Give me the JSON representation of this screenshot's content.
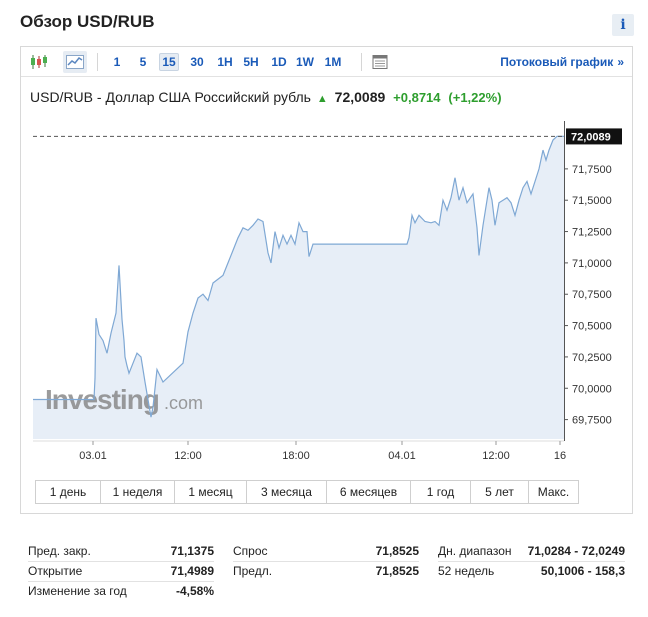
{
  "page_title": "Обзор USD/RUB",
  "info_label": "i",
  "toolbar": {
    "intervals": [
      "1",
      "5",
      "15",
      "30",
      "1H",
      "5H",
      "1D",
      "1W",
      "1M"
    ],
    "active_interval": "15",
    "streaming_label": "Потоковый график",
    "streaming_chevron": "»"
  },
  "quote": {
    "name": "USD/RUB - Доллар США Российский рубль",
    "price": "72,0089",
    "change": "+0,8714",
    "change_pct": "(+1,22%)",
    "direction_color": "#2e9e2e"
  },
  "watermark": {
    "brand": "Investing",
    "suffix": ".com"
  },
  "ranges": [
    "1 день",
    "1 неделя",
    "1 месяц",
    "3 месяца",
    "6 месяцев",
    "1 год",
    "5 лет",
    "Макс."
  ],
  "stats": [
    [
      {
        "label": "Пред. закр.",
        "value": "71,1375"
      },
      {
        "label": "Открытие",
        "value": "71,4989"
      },
      {
        "label": "Изменение за год",
        "value": "-4,58%"
      }
    ],
    [
      {
        "label": "Спрос",
        "value": "71,8525"
      },
      {
        "label": "Предл.",
        "value": "71,8525"
      }
    ],
    [
      {
        "label": "Дн. диапазон",
        "value": "71,0284 - 72,0249"
      },
      {
        "label": "52 недель",
        "value": "50,1006 - 158,3"
      }
    ]
  ],
  "chart_data": {
    "type": "area",
    "ylim": [
      69.675,
      72.1
    ],
    "y_ticks": [
      69.75,
      70.0,
      70.25,
      70.5,
      70.75,
      71.0,
      71.25,
      71.5,
      71.75
    ],
    "y_tick_labels": [
      "69,7500",
      "70,0000",
      "70,2500",
      "70,5000",
      "70,7500",
      "71,0000",
      "71,2500",
      "71,5000",
      "71,7500"
    ],
    "x_tick_labels": [
      "03.01",
      "12:00",
      "18:00",
      "04.01",
      "12:00",
      "16"
    ],
    "last_value": 72.0089,
    "last_label": "72,0089",
    "line_color": "#7fa8d4",
    "fill_color": "#e7eef7",
    "series": [
      {
        "points": [
          [
            0,
            69.91
          ],
          [
            61,
            69.91
          ],
          [
            62,
            70.08
          ],
          [
            63,
            70.56
          ],
          [
            66,
            70.43
          ],
          [
            70,
            70.38
          ],
          [
            74,
            70.28
          ],
          [
            78,
            70.44
          ],
          [
            83,
            70.6
          ],
          [
            86,
            70.98
          ],
          [
            89,
            70.55
          ],
          [
            91,
            70.38
          ],
          [
            92,
            70.25
          ],
          [
            94,
            70.18
          ],
          [
            96,
            70.12
          ],
          [
            100,
            70.2
          ],
          [
            104,
            70.28
          ],
          [
            108,
            70.25
          ],
          [
            112,
            70.05
          ],
          [
            118,
            69.77
          ],
          [
            120,
            69.85
          ],
          [
            124,
            70.15
          ],
          [
            130,
            70.05
          ],
          [
            150,
            70.2
          ],
          [
            155,
            70.45
          ],
          [
            160,
            70.6
          ],
          [
            165,
            70.72
          ],
          [
            170,
            70.75
          ],
          [
            175,
            70.7
          ],
          [
            180,
            70.84
          ],
          [
            190,
            70.9
          ],
          [
            195,
            71.0
          ],
          [
            200,
            71.1
          ],
          [
            205,
            71.2
          ],
          [
            210,
            71.28
          ],
          [
            215,
            71.26
          ],
          [
            220,
            71.3
          ],
          [
            225,
            71.35
          ],
          [
            230,
            71.33
          ],
          [
            235,
            71.08
          ],
          [
            238,
            71.0
          ],
          [
            242,
            71.25
          ],
          [
            246,
            71.12
          ],
          [
            250,
            71.22
          ],
          [
            254,
            71.15
          ],
          [
            258,
            71.22
          ],
          [
            262,
            71.15
          ],
          [
            266,
            71.32
          ],
          [
            270,
            71.25
          ],
          [
            274,
            71.25
          ],
          [
            276,
            71.05
          ],
          [
            280,
            71.15
          ],
          [
            290,
            71.15
          ],
          [
            330,
            71.15
          ],
          [
            368,
            71.15
          ],
          [
            374,
            71.15
          ],
          [
            376,
            71.2
          ],
          [
            379,
            71.38
          ],
          [
            382,
            71.32
          ],
          [
            386,
            71.38
          ],
          [
            392,
            71.33
          ],
          [
            398,
            71.32
          ],
          [
            402,
            71.33
          ],
          [
            406,
            71.3
          ],
          [
            410,
            71.5
          ],
          [
            414,
            71.42
          ],
          [
            418,
            71.52
          ],
          [
            422,
            71.68
          ],
          [
            426,
            71.5
          ],
          [
            430,
            71.6
          ],
          [
            434,
            71.48
          ],
          [
            440,
            71.55
          ],
          [
            444,
            71.28
          ],
          [
            446,
            71.06
          ],
          [
            450,
            71.3
          ],
          [
            456,
            71.6
          ],
          [
            459,
            71.5
          ],
          [
            462,
            71.3
          ],
          [
            466,
            71.48
          ],
          [
            470,
            71.5
          ],
          [
            474,
            71.52
          ],
          [
            478,
            71.48
          ],
          [
            482,
            71.38
          ],
          [
            486,
            71.5
          ],
          [
            490,
            71.6
          ],
          [
            494,
            71.65
          ],
          [
            498,
            71.55
          ],
          [
            502,
            71.65
          ],
          [
            506,
            71.75
          ],
          [
            510,
            71.9
          ],
          [
            513,
            71.82
          ],
          [
            516,
            71.9
          ],
          [
            520,
            71.98
          ],
          [
            524,
            72.01
          ],
          [
            531,
            72.01
          ]
        ]
      }
    ]
  }
}
